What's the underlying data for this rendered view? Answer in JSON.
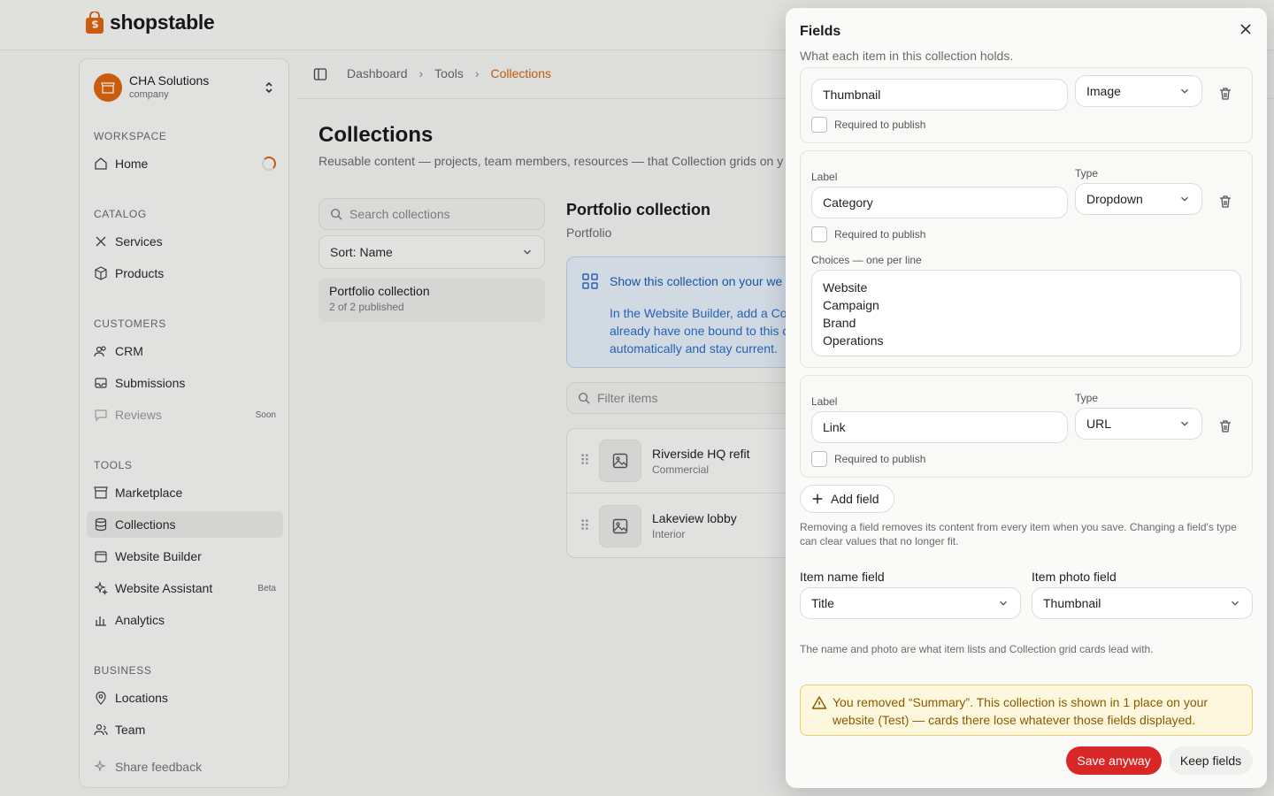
{
  "brand": {
    "name": "shopstable",
    "accent": "#e2660f"
  },
  "sidebar": {
    "workspace": {
      "name": "CHA Solutions",
      "type": "company"
    },
    "sections": {
      "workspace": "WORKSPACE",
      "catalog": "CATALOG",
      "customers": "CUSTOMERS",
      "tools": "TOOLS",
      "business": "BUSINESS"
    },
    "items": [
      {
        "label": "Home",
        "icon": "home-icon"
      },
      {
        "label": "Services",
        "icon": "tools-icon"
      },
      {
        "label": "Products",
        "icon": "box-icon"
      },
      {
        "label": "CRM",
        "icon": "users-icon"
      },
      {
        "label": "Submissions",
        "icon": "inbox-icon"
      },
      {
        "label": "Reviews",
        "icon": "chat-icon",
        "tag": "Soon"
      },
      {
        "label": "Marketplace",
        "icon": "store-icon"
      },
      {
        "label": "Collections",
        "icon": "database-icon"
      },
      {
        "label": "Website Builder",
        "icon": "browser-icon"
      },
      {
        "label": "Website Assistant",
        "icon": "sparkle-icon",
        "tag": "Beta"
      },
      {
        "label": "Analytics",
        "icon": "chart-icon"
      },
      {
        "label": "Locations",
        "icon": "pin-icon"
      },
      {
        "label": "Team",
        "icon": "team-icon"
      },
      {
        "label": "Share feedback",
        "icon": "sparkle-icon"
      }
    ]
  },
  "breadcrumb": [
    "Dashboard",
    "Tools",
    "Collections"
  ],
  "page": {
    "title": "Collections",
    "subtitle": "Reusable content — projects, team members, resources — that Collection grids on y"
  },
  "collections": {
    "search_placeholder": "Search collections",
    "sort": "Sort: Name",
    "list": [
      {
        "name": "Portfolio collection",
        "status": "2 of 2 published"
      }
    ]
  },
  "detail": {
    "title": "Portfolio collection",
    "subtitle": "Portfolio",
    "info_title": "Show this collection on your we",
    "info_body": [
      "In the Website Builder, add a Co",
      "already have one bound to this c",
      "automatically and stay current."
    ],
    "filter_placeholder": "Filter items",
    "items": [
      {
        "name": "Riverside HQ refit",
        "category": "Commercial"
      },
      {
        "name": "Lakeview lobby",
        "category": "Interior"
      }
    ]
  },
  "panel": {
    "title": "Fields",
    "description": "What each item in this collection holds.",
    "label_caption": "Label",
    "type_caption": "Type",
    "required_label": "Required to publish",
    "choices_caption": "Choices — one per line",
    "fields": [
      {
        "label": "Thumbnail",
        "type": "Image"
      },
      {
        "label": "Category",
        "type": "Dropdown",
        "choices": [
          "Website",
          "Campaign",
          "Brand",
          "Operations"
        ]
      },
      {
        "label": "Link",
        "type": "URL"
      }
    ],
    "add_field": "Add field",
    "note": "Removing a field removes its content from every item when you save. Changing a field's type can clear values that no longer fit.",
    "item_name_label": "Item name field",
    "item_name_value": "Title",
    "item_photo_label": "Item photo field",
    "item_photo_value": "Thumbnail",
    "note2": "The name and photo are what item lists and Collection grid cards lead with.",
    "warning": "You removed “Summary”. This collection is shown in 1 place on your website (Test) — cards there lose whatever those fields displayed.",
    "save_anyway": "Save anyway",
    "keep_fields": "Keep fields"
  }
}
